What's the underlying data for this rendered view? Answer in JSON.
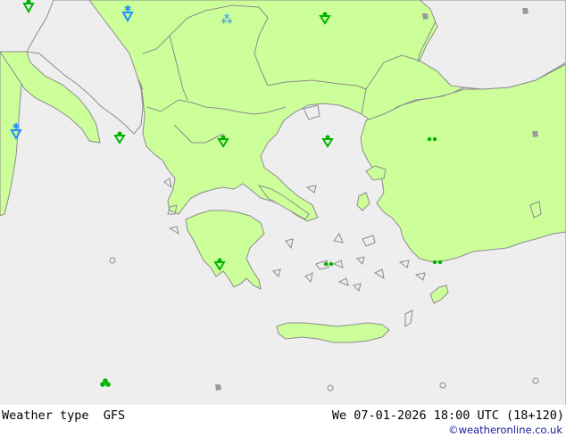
{
  "map": {
    "sea_color": "#eeeeee",
    "land_color": "#ccff99",
    "border_color": "#8c8c8c",
    "symbols": [
      {
        "kind": "rain-shower",
        "color": "#00b400"
      },
      {
        "kind": "snow-shower",
        "color": "#1e90ff"
      },
      {
        "kind": "snow",
        "color": "#1e90ff"
      },
      {
        "kind": "drizzle",
        "color": "#00b400"
      },
      {
        "kind": "cloud",
        "color": "#00b400"
      },
      {
        "kind": "thunder-cloud",
        "color": "#9a9a9a"
      }
    ]
  },
  "footer": {
    "left_label": "Weather type  GFS",
    "right_label": "We 07-01-2026 18:00 UTC (18+120)",
    "credit": "©weatheronline.co.uk"
  }
}
